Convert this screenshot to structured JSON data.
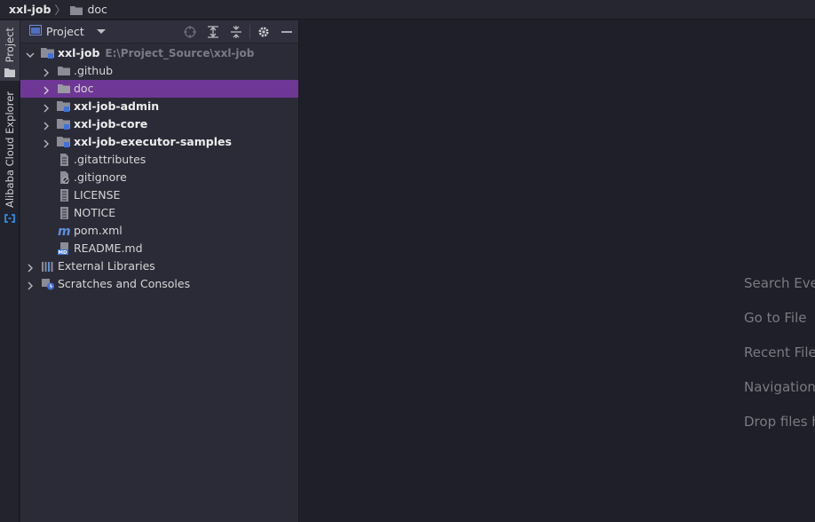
{
  "breadcrumb": {
    "root": "xxl-job",
    "folder": "doc"
  },
  "tool_stripe": {
    "project_tab": "Project",
    "alibaba_tab": "Alibaba Cloud Explorer"
  },
  "panel": {
    "title": "Project"
  },
  "tree": {
    "root": {
      "label": "xxl-job",
      "path": "E:\\Project_Source\\xxl-job"
    },
    "items": [
      {
        "label": ".github"
      },
      {
        "label": "doc"
      },
      {
        "label": "xxl-job-admin"
      },
      {
        "label": "xxl-job-core"
      },
      {
        "label": "xxl-job-executor-samples"
      },
      {
        "label": ".gitattributes"
      },
      {
        "label": ".gitignore"
      },
      {
        "label": "LICENSE"
      },
      {
        "label": "NOTICE"
      },
      {
        "label": "pom.xml"
      },
      {
        "label": "README.md"
      }
    ],
    "external_libraries": "External Libraries",
    "scratches": "Scratches and Consoles"
  },
  "editor_hints": [
    "Search Eve",
    "Go to File",
    "Recent File",
    "Navigation",
    "Drop files h"
  ],
  "colors": {
    "selection": "#6e3795",
    "background": "#1f1f29",
    "panel": "#2b2b38"
  }
}
